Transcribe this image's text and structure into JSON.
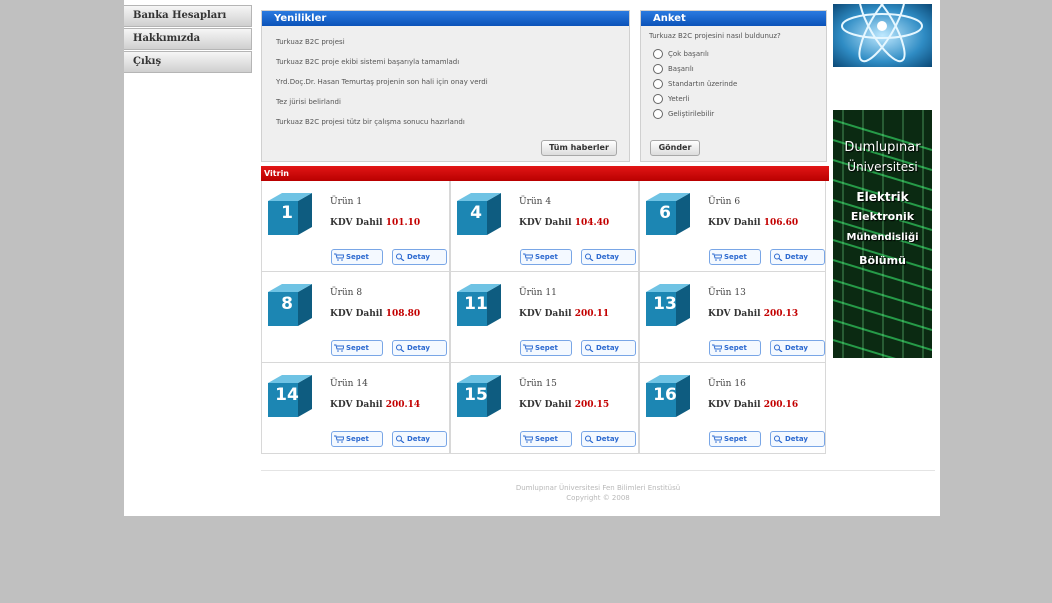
{
  "menu": {
    "items": [
      "Banka Hesapları",
      "Hakkımızda",
      "Çıkış"
    ]
  },
  "news": {
    "title": "Yenilikler",
    "items": [
      "Turkuaz B2C projesi",
      "Turkuaz B2C proje ekibi sistemi başarıyla tamamladı",
      "Yrd.Doç.Dr. Hasan Temurtaş projenin son hali için onay verdi",
      "Tez jürisi belirlandi",
      "Turkuaz B2C projesi tütz bir çalışma sonucu hazırlandı"
    ],
    "all_button": "Tüm haberler"
  },
  "poll": {
    "title": "Anket",
    "question": "Turkuaz B2C projesini nasıl buldunuz?",
    "options": [
      "Çok başarılı",
      "Başarılı",
      "Standartın üzerinde",
      "Yeterli",
      "Geliştirilebilir"
    ],
    "send_button": "Gönder"
  },
  "vitrin": {
    "title": "Vitrin",
    "kdv_label": "KDV Dahil",
    "cart_label": "Sepet",
    "detail_label": "Detay",
    "products": [
      {
        "num": "1",
        "name": "Ürün 1",
        "price": "101.10"
      },
      {
        "num": "4",
        "name": "Ürün 4",
        "price": "104.40"
      },
      {
        "num": "6",
        "name": "Ürün 6",
        "price": "106.60"
      },
      {
        "num": "8",
        "name": "Ürün 8",
        "price": "108.80"
      },
      {
        "num": "11",
        "name": "Ürün 11",
        "price": "200.11"
      },
      {
        "num": "13",
        "name": "Ürün 13",
        "price": "200.13"
      },
      {
        "num": "14",
        "name": "Ürün 14",
        "price": "200.14"
      },
      {
        "num": "15",
        "name": "Ürün 15",
        "price": "200.15"
      },
      {
        "num": "16",
        "name": "Ürün 16",
        "price": "200.16"
      }
    ]
  },
  "banner": {
    "lines": [
      "Dumlupınar",
      "Üniversitesi",
      "Elektrik",
      "Elektronik",
      "Mühendisliği",
      "Bölümü"
    ]
  },
  "footer": {
    "line1": "Dumlupınar Üniversitesi Fen Bilimleri Enstitüsü",
    "line2": "Copyright © 2008"
  },
  "colors": {
    "news_head": "#0b52b8",
    "vitrin_head": "#c30000",
    "price": "#c30000",
    "cube": "#1a7fa8"
  }
}
